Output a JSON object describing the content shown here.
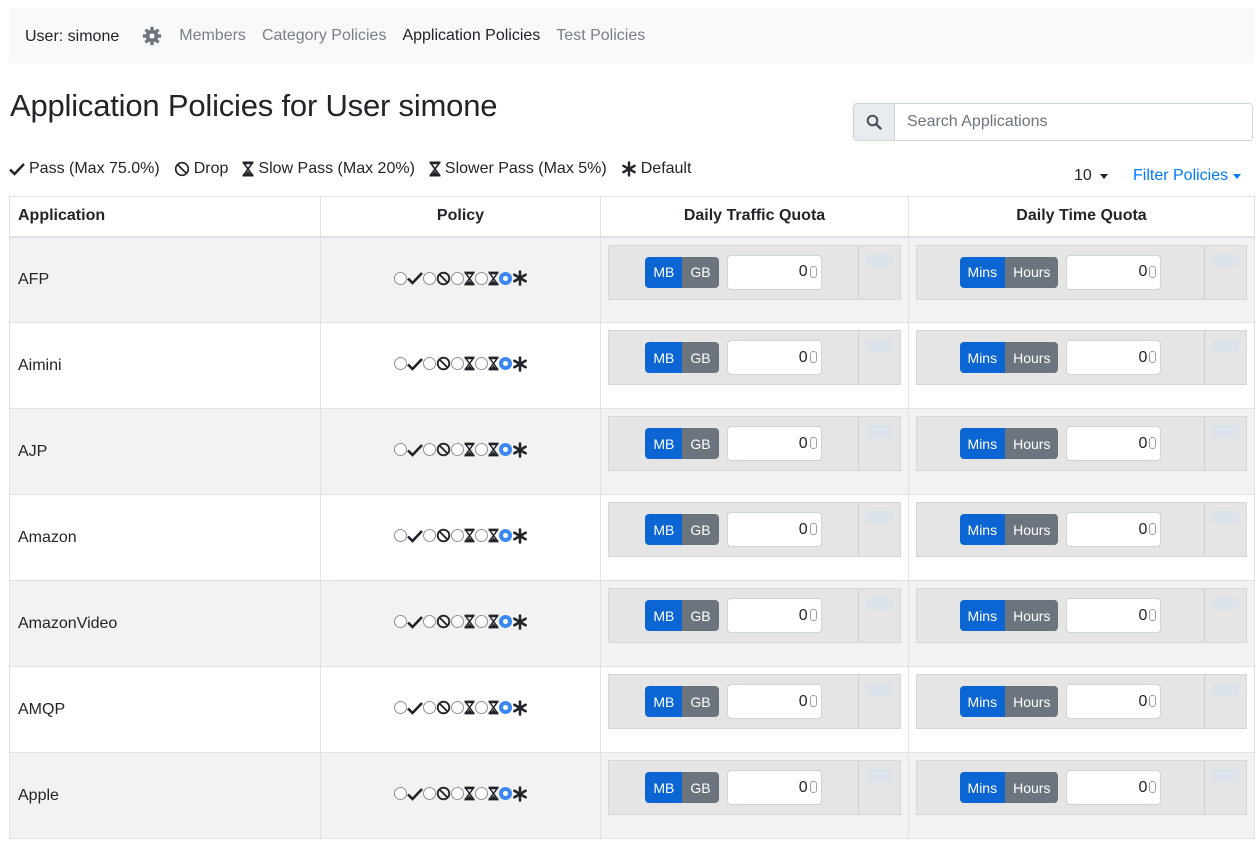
{
  "nav": {
    "user_label": "User: simone",
    "links": [
      "Members",
      "Category Policies",
      "Application Policies",
      "Test Policies"
    ],
    "active": "Application Policies"
  },
  "page": {
    "title": "Application Policies for User simone",
    "search_placeholder": "Search Applications"
  },
  "legend": [
    {
      "icon": "check-icon",
      "label": "Pass (Max 75.0%)"
    },
    {
      "icon": "ban-icon",
      "label": "Drop"
    },
    {
      "icon": "hourglass-icon",
      "label": "Slow Pass (Max 20%)"
    },
    {
      "icon": "hourglass-icon",
      "label": "Slower Pass (Max 5%)"
    },
    {
      "icon": "asterisk-icon",
      "label": "Default"
    }
  ],
  "controls": {
    "page_size": "10",
    "filter_label": "Filter Policies"
  },
  "table": {
    "headers": [
      "Application",
      "Policy",
      "Daily Traffic Quota",
      "Daily Time Quota"
    ],
    "traffic_units": [
      "MB",
      "GB"
    ],
    "time_units": [
      "Mins",
      "Hours"
    ],
    "rows": [
      {
        "app": "AFP",
        "policy": "default",
        "traffic_quota": "0",
        "traffic_unit": "MB",
        "time_quota": "0",
        "time_unit": "Mins"
      },
      {
        "app": "Aimini",
        "policy": "default",
        "traffic_quota": "0",
        "traffic_unit": "MB",
        "time_quota": "0",
        "time_unit": "Mins"
      },
      {
        "app": "AJP",
        "policy": "default",
        "traffic_quota": "0",
        "traffic_unit": "MB",
        "time_quota": "0",
        "time_unit": "Mins"
      },
      {
        "app": "Amazon",
        "policy": "default",
        "traffic_quota": "0",
        "traffic_unit": "MB",
        "time_quota": "0",
        "time_unit": "Mins"
      },
      {
        "app": "AmazonVideo",
        "policy": "default",
        "traffic_quota": "0",
        "traffic_unit": "MB",
        "time_quota": "0",
        "time_unit": "Mins"
      },
      {
        "app": "AMQP",
        "policy": "default",
        "traffic_quota": "0",
        "traffic_unit": "MB",
        "time_quota": "0",
        "time_unit": "Mins"
      },
      {
        "app": "Apple",
        "policy": "default",
        "traffic_quota": "0",
        "traffic_unit": "MB",
        "time_quota": "0",
        "time_unit": "Mins"
      }
    ]
  },
  "colors": {
    "primary": "#007bff",
    "toggle_active": "#0b66d4",
    "toggle_inactive": "#6c757d",
    "radio_checked": "#3b88f5",
    "nav_bg": "#f8f9fa",
    "stripe": "#f2f2f2"
  }
}
